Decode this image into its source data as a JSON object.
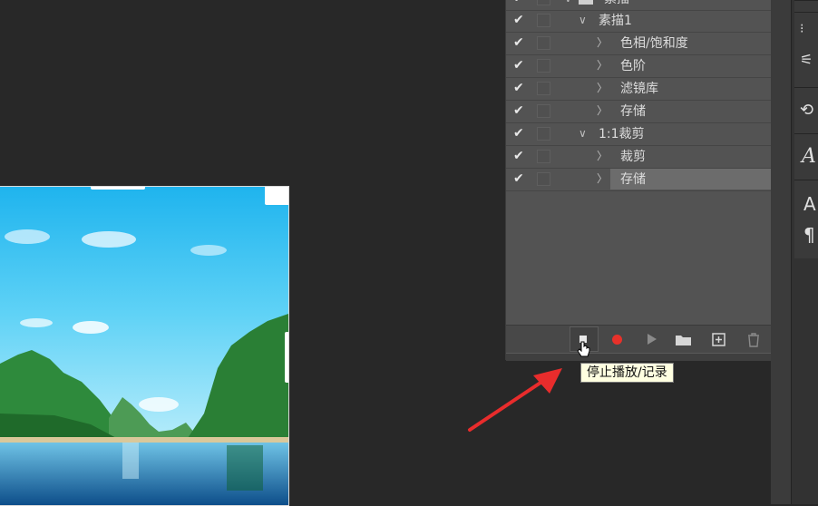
{
  "actions_panel": {
    "set_label": "素描",
    "rows": [
      {
        "label": "素描1",
        "level": 1,
        "checked": true
      },
      {
        "label": "色相/饱和度",
        "level": 2,
        "checked": true
      },
      {
        "label": "色阶",
        "level": 2,
        "checked": true
      },
      {
        "label": "滤镜库",
        "level": 2,
        "checked": true
      },
      {
        "label": "存储",
        "level": 2,
        "checked": true
      },
      {
        "label": "1:1裁剪",
        "level": 1,
        "checked": true
      },
      {
        "label": "裁剪",
        "level": 2,
        "checked": true
      },
      {
        "label": "存储",
        "level": 2,
        "checked": true,
        "selected": true
      }
    ],
    "check_glyph": "✔",
    "expand_glyph": "〉",
    "collapse_glyph": "∨",
    "toolbar": {
      "stop": "stop-icon",
      "record": "record-icon",
      "play": "play-icon",
      "new_set": "folder-icon",
      "new_action": "new-action-icon",
      "delete": "trash-icon"
    }
  },
  "tooltip": {
    "text": "停止播放/记录"
  },
  "colors": {
    "record": "#e8312a",
    "arrow": "#e82c2c",
    "selected_row": "#6c6c6c"
  },
  "right_tools": [
    "brush-settings-icon",
    "adjustments-icon",
    "history-icon",
    "character-icon",
    "glyphs-icon",
    "paragraph-icon"
  ]
}
